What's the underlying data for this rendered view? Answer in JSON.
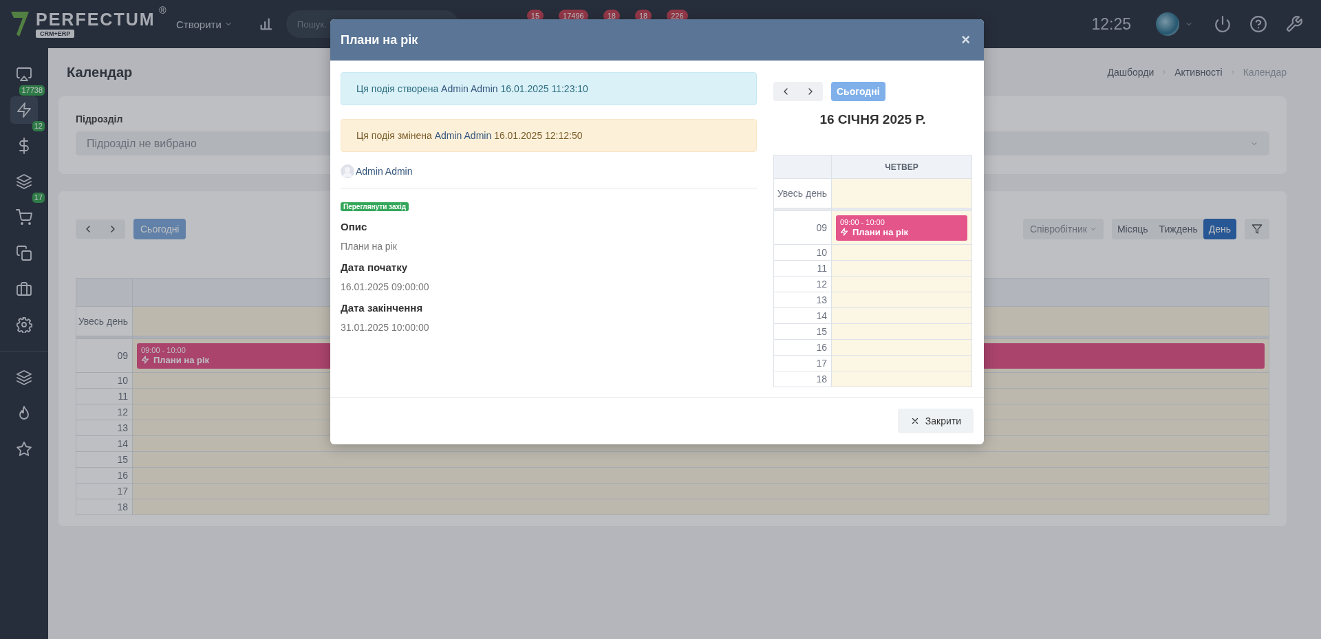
{
  "topbar": {
    "logo": {
      "name": "PERFECTUM",
      "registered": "®",
      "tagline": "CRM+ERP"
    },
    "create_menu": "Створити",
    "search": {
      "placeholder": "Пошук."
    },
    "counters": [
      "15",
      "17496",
      "18",
      "18",
      "226"
    ],
    "time": "12:25"
  },
  "sidebar": {
    "items": [
      {
        "kind": "monitor",
        "selected": false
      },
      {
        "kind": "bolt",
        "badge": "17738",
        "selected": true
      },
      {
        "kind": "dollar",
        "badge": "12",
        "selected": false
      },
      {
        "kind": "layers",
        "selected": false
      },
      {
        "kind": "cart",
        "badge": "17",
        "selected": false
      },
      {
        "kind": "copy",
        "selected": false
      },
      {
        "kind": "briefcase",
        "selected": false
      },
      {
        "kind": "gear",
        "selected": false
      }
    ],
    "bottom_items": [
      {
        "kind": "layers",
        "selected": false
      },
      {
        "kind": "flame",
        "selected": false
      },
      {
        "kind": "star",
        "selected": false
      }
    ]
  },
  "page": {
    "title": "Календар",
    "breadcrumbs": [
      "Дашборди",
      "Активності",
      "Календар"
    ],
    "department": {
      "label": "Підрозділ",
      "placeholder": "Підрозділ не вибрано"
    },
    "calendar": {
      "today": "Сьогодні",
      "employee": "Співробітник",
      "views": [
        {
          "label": "Місяць",
          "selected": false
        },
        {
          "label": "Тиждень",
          "selected": false
        },
        {
          "label": "День",
          "selected": true
        }
      ],
      "all_day": "Увесь день",
      "hours": [
        {
          "label": "09",
          "events": [
            {
              "time": "09:00 - 10:00",
              "title": "Плани на рік"
            }
          ]
        },
        {
          "label": "10"
        },
        {
          "label": "11"
        },
        {
          "label": "12"
        },
        {
          "label": "13"
        },
        {
          "label": "14"
        },
        {
          "label": "15"
        },
        {
          "label": "16"
        },
        {
          "label": "17"
        },
        {
          "label": "18"
        }
      ]
    }
  },
  "modal": {
    "title": "Плани на рік",
    "close": "×",
    "notices": [
      {
        "kind": "info",
        "text": "Ця подія створена",
        "author": "Admin Admin",
        "time": "16.01.2025 11:23:10"
      },
      {
        "kind": "warning",
        "text": "Ця подія змінена",
        "author": "Admin Admin",
        "time": "16.01.2025 12:12:50"
      }
    ],
    "owner": "Admin Admin",
    "tag": "Переглянути захід",
    "fields": [
      {
        "label": "Опис",
        "value": "Плани на рік"
      },
      {
        "label": "Дата початку",
        "value": "16.01.2025 09:00:00"
      },
      {
        "label": "Дата закінчення",
        "value": "31.01.2025 10:00:00"
      }
    ],
    "calendar": {
      "today": "Сьогодні",
      "date_title": "16 СІЧНЯ 2025 Р.",
      "day_header": "ЧЕТВЕР",
      "all_day": "Увесь день",
      "hours": [
        {
          "label": "09",
          "events": [
            {
              "time": "09:00 - 10:00",
              "title": "Плани на рік"
            }
          ]
        },
        {
          "label": "10"
        },
        {
          "label": "11"
        },
        {
          "label": "12"
        },
        {
          "label": "13"
        },
        {
          "label": "14"
        },
        {
          "label": "15"
        },
        {
          "label": "16"
        },
        {
          "label": "17"
        },
        {
          "label": "18"
        }
      ]
    },
    "close_button": "Закрити"
  }
}
